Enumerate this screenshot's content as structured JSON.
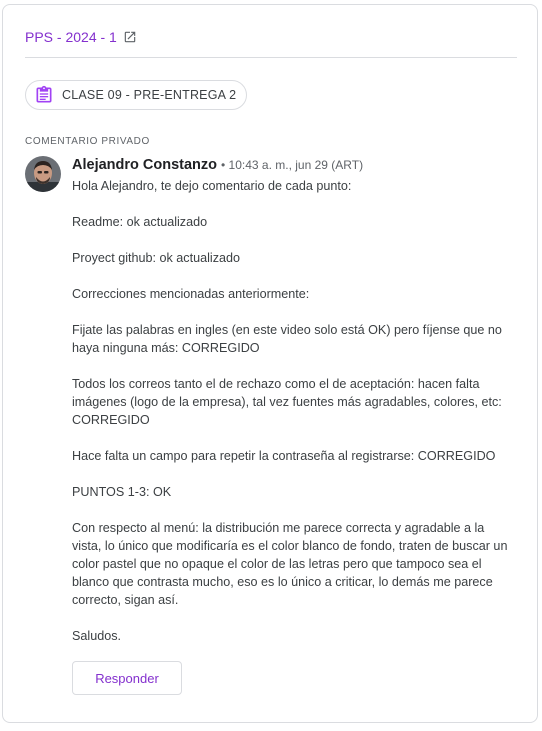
{
  "course": {
    "title": "PPS - 2024 - 1",
    "icon": "open-in-new-icon"
  },
  "assignment": {
    "title": "CLASE 09 - PRE-ENTREGA 2",
    "icon": "assignment-icon",
    "accent": "#a142f4"
  },
  "section": {
    "label": "COMENTARIO PRIVADO"
  },
  "comment": {
    "author": "Alejandro Constanzo",
    "meta": "• 10:43 a. m., jun 29 (ART)",
    "paragraphs": [
      "Hola Alejandro, te dejo comentario de cada punto:",
      "Readme: ok actualizado",
      "Proyect github: ok actualizado",
      "Correcciones mencionadas anteriormente:",
      "Fijate las palabras en ingles (en este video solo está OK) pero fíjense que no haya ninguna más: CORREGIDO",
      "Todos los correos tanto el de rechazo como el de aceptación: hacen falta imágenes (logo de la empresa), tal vez fuentes más agradables, colores, etc: CORREGIDO",
      "Hace falta un campo para repetir la contraseña al registrarse: CORREGIDO",
      "PUNTOS 1-3: OK",
      "Con respecto al menú: la distribución me parece correcta y agradable a la vista, lo único que modificaría es el color blanco de fondo, traten de buscar un color pastel que no opaque el color de las letras pero que tampoco sea el blanco que contrasta mucho, eso es lo único a criticar, lo demás me parece correcto, sigan así.",
      "Saludos."
    ]
  },
  "actions": {
    "reply_label": "Responder"
  },
  "colors": {
    "link": "#8430ce",
    "border": "#dadce0"
  }
}
